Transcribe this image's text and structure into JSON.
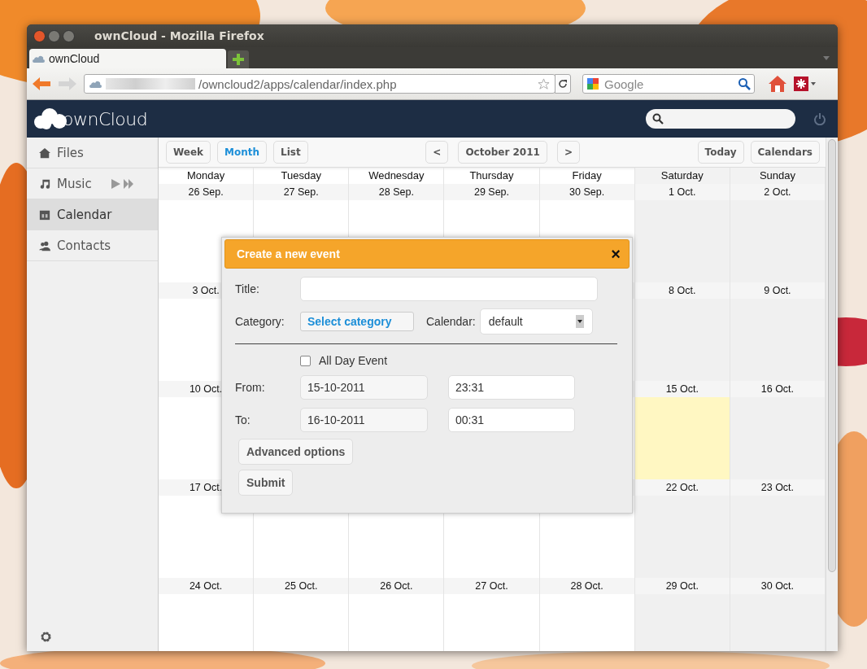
{
  "window": {
    "title": "ownCloud - Mozilla Firefox"
  },
  "browser": {
    "tab": "ownCloud",
    "url": "/owncloud2/apps/calendar/index.php",
    "search_placeholder": "Google"
  },
  "app": {
    "logo": "ownCloud"
  },
  "sidebar": {
    "items": [
      {
        "label": "Files",
        "selected": false
      },
      {
        "label": "Music",
        "selected": false
      },
      {
        "label": "Calendar",
        "selected": true
      },
      {
        "label": "Contacts",
        "selected": false
      }
    ]
  },
  "toolbar": {
    "views": [
      {
        "label": "Week",
        "selected": false
      },
      {
        "label": "Month",
        "selected": true
      },
      {
        "label": "List",
        "selected": false
      }
    ],
    "prev": "<",
    "period": "October 2011",
    "next": ">",
    "today": "Today",
    "calendars": "Calendars"
  },
  "calendar": {
    "columns": [
      {
        "label": "Monday",
        "weekend": false
      },
      {
        "label": "Tuesday",
        "weekend": false
      },
      {
        "label": "Wednesday",
        "weekend": false
      },
      {
        "label": "Thursday",
        "weekend": false
      },
      {
        "label": "Friday",
        "weekend": false
      },
      {
        "label": "Saturday",
        "weekend": true
      },
      {
        "label": "Sunday",
        "weekend": true
      }
    ],
    "weeks": [
      [
        {
          "label": "26 Sep.",
          "today": false
        },
        {
          "label": "27 Sep.",
          "today": false
        },
        {
          "label": "28 Sep.",
          "today": false
        },
        {
          "label": "29 Sep.",
          "today": false
        },
        {
          "label": "30 Sep.",
          "today": false
        },
        {
          "label": "1 Oct.",
          "today": false
        },
        {
          "label": "2 Oct.",
          "today": false
        }
      ],
      [
        {
          "label": "3 Oct.",
          "today": false
        },
        {
          "label": "8 Oct.",
          "today": false
        },
        {
          "label": "9 Oct.",
          "today": false
        }
      ],
      [
        {
          "label": "10 Oct.",
          "today": false
        },
        {
          "label": "15 Oct.",
          "today": true
        },
        {
          "label": "16 Oct.",
          "today": false
        }
      ],
      [
        {
          "label": "17 Oct.",
          "today": false
        },
        {
          "label": "22 Oct.",
          "today": false
        },
        {
          "label": "23 Oct.",
          "today": false
        }
      ],
      [
        {
          "label": "24 Oct.",
          "today": false
        },
        {
          "label": "25 Oct.",
          "today": false
        },
        {
          "label": "26 Oct.",
          "today": false
        },
        {
          "label": "27 Oct.",
          "today": false
        },
        {
          "label": "28 Oct.",
          "today": false
        },
        {
          "label": "29 Oct.",
          "today": false
        },
        {
          "label": "30 Oct.",
          "today": false
        }
      ]
    ]
  },
  "dialog": {
    "title": "Create a new event",
    "close": "×",
    "title_label": "Title:",
    "category_label": "Category:",
    "category_button": "Select category",
    "calendar_label": "Calendar:",
    "calendar_value": "default",
    "all_day_label": "All Day Event",
    "all_day": false,
    "from_label": "From:",
    "from_date": "15-10-2011",
    "from_time": "23:31",
    "to_label": "To:",
    "to_date": "16-10-2011",
    "to_time": "00:31",
    "advanced": "Advanced options",
    "submit": "Submit"
  }
}
